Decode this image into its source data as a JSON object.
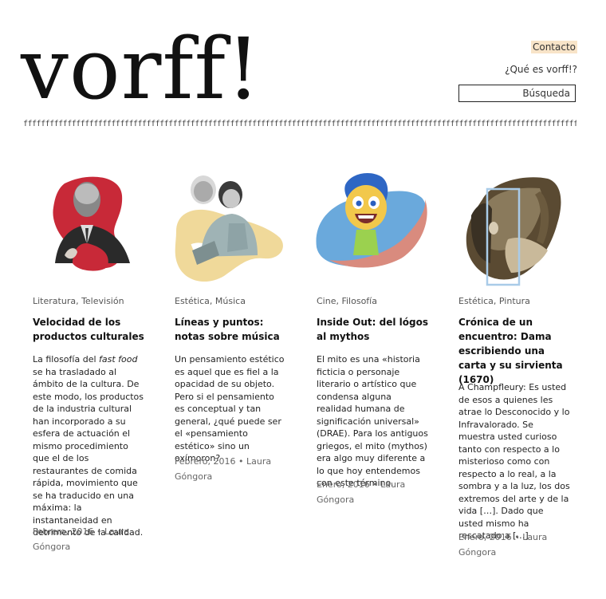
{
  "site": {
    "logo": "vorff!",
    "nav": {
      "contact": "Contacto",
      "about": "¿Qué es vorff!?"
    },
    "search": {
      "placeholder": "Búsqueda"
    },
    "divider": "ffffffffffffffffffffffffffffffffffffffffffffffffffffffffffffffffffffffffffffffffffffffffffffffffffffffffffffffffffffffffffffffffffffffff"
  },
  "posts": [
    {
      "categories": "Literatura, Televisión",
      "title": "Velocidad de los productos culturales",
      "excerpt": {
        "before": "La filosofía del ",
        "em": "fast food",
        "after": " se ha trasladado al ámbito de la cultura. De este modo, los productos de la industria cultural han incorporado a su esfera de actuación el mismo procedimiento que el de los restaurantes de comida rápida, movimiento que se ha traducido en una máxima: la instantaneidad en detrimento de la calidad."
      },
      "date": "Febrero, 2016",
      "author": "Laura Góngora",
      "accent": "#c82938"
    },
    {
      "categories": "Estética, Música",
      "title": "Líneas y puntos: notas sobre música",
      "excerpt": "Un pensamiento estético es aquel que es fiel a la opacidad de su objeto. Pero si el pensamiento es conceptual y tan general, ¿qué puede ser el «pensamiento estético» sino un oxímoron?",
      "date": "Febrero, 2016",
      "author": "Laura Góngora",
      "accent": "#f0d99a"
    },
    {
      "categories": "Cine, Filosofía",
      "title": "Inside Out: del lógos al mythos",
      "excerpt": "El mito es una «historia ficticia o personaje literario o artístico que condensa alguna realidad humana de significación universal» (DRAE). Para los antiguos griegos, el mito (mythos) era algo muy diferente a lo que hoy entendemos con este término.",
      "date": "Enero, 2016",
      "author": "Laura Góngora",
      "accent": "#6aa9dc"
    },
    {
      "categories": "Estética, Pintura",
      "title": "Crónica de un encuentro: Dama escribiendo una carta y su sirvienta (1670)",
      "excerpt": "A Champfleury: Es usted de esos a quienes les atrae lo Desconocido y lo Infravalorado. Se muestra usted curioso tanto con respecto a lo misterioso como con respecto a lo real, a la sombra y a la luz, los dos extremos del arte y de la vida […]. Dado que usted mismo ha rescatado a […]",
      "date": "Enero, 2016",
      "author": "Laura Góngora",
      "accent": "#a9cbe8"
    }
  ],
  "meta_separator": "•"
}
